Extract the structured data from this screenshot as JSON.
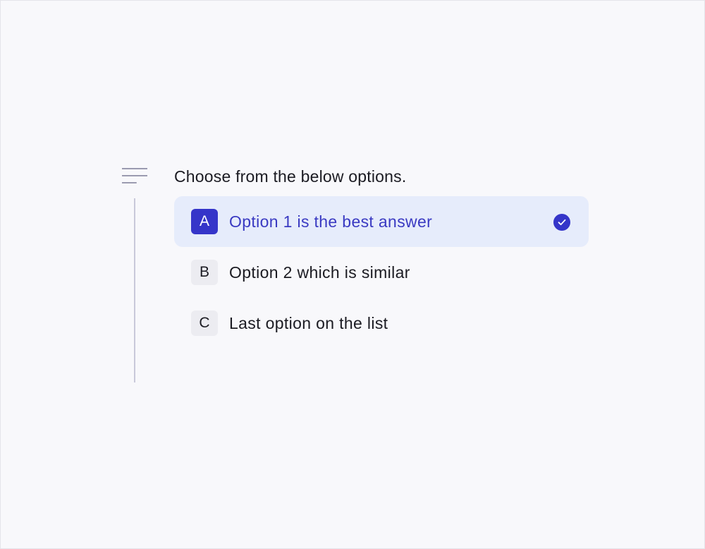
{
  "question": "Choose from the below options.",
  "options": [
    {
      "key": "A",
      "label": "Option 1 is the best answer",
      "selected": true
    },
    {
      "key": "B",
      "label": "Option 2 which is similar",
      "selected": false
    },
    {
      "key": "C",
      "label": "Last option on the list",
      "selected": false
    }
  ],
  "icons": {
    "menu": "text-align-left-icon",
    "selected": "check-circle-icon"
  },
  "colors": {
    "background": "#f8f8fb",
    "accent": "#3535c9",
    "selected_row": "#e6ecfb",
    "selected_text": "#3a3ac2",
    "key_background": "#ececf1",
    "text": "#1b1b22",
    "menu_icon": "#9b9bb0",
    "rail": "#c9c9da"
  }
}
